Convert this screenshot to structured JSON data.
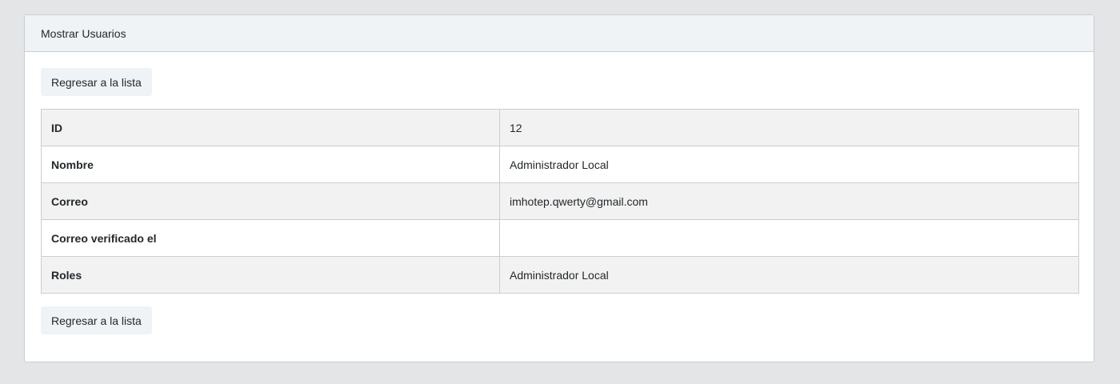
{
  "card": {
    "title": "Mostrar Usuarios"
  },
  "buttons": {
    "back_top": "Regresar a la lista",
    "back_bottom": "Regresar a la lista"
  },
  "details": [
    {
      "label": "ID",
      "value": "12"
    },
    {
      "label": "Nombre",
      "value": "Administrador Local"
    },
    {
      "label": "Correo",
      "value": "imhotep.qwerty@gmail.com"
    },
    {
      "label": "Correo verificado el",
      "value": ""
    },
    {
      "label": "Roles",
      "value": "Administrador Local"
    }
  ],
  "colors": {
    "page_background": "#e4e5e6",
    "card_header_background": "#f0f3f5",
    "border": "#c8ced3",
    "striped_row": "#f2f2f2",
    "button_background": "#f0f3f5"
  }
}
